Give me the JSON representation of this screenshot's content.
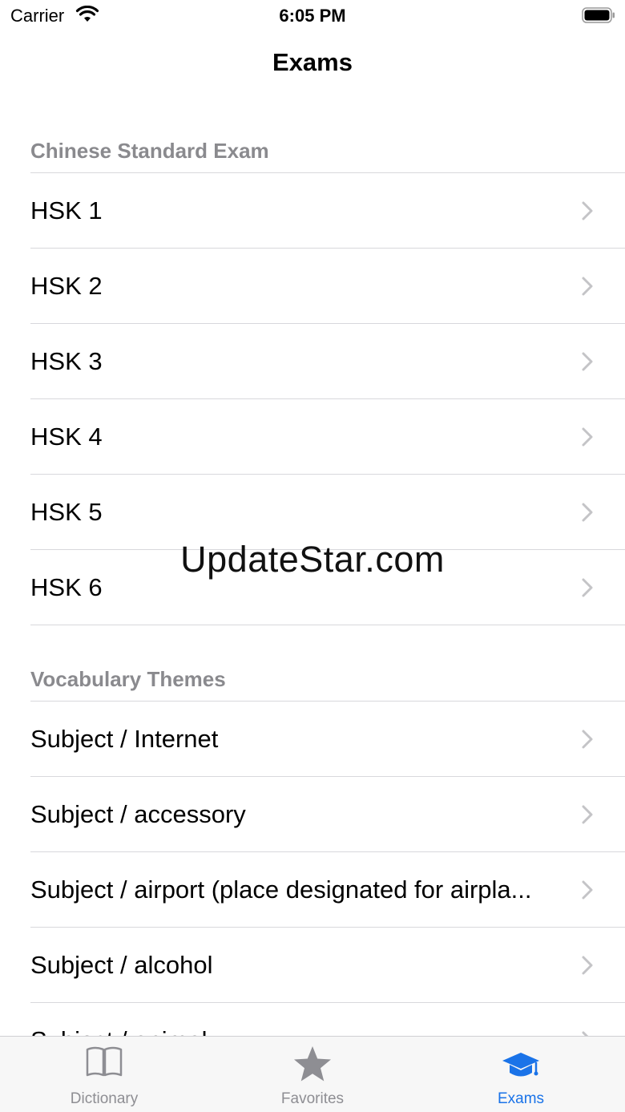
{
  "status": {
    "carrier": "Carrier",
    "time": "6:05 PM"
  },
  "nav": {
    "title": "Exams"
  },
  "sections": [
    {
      "header": "Chinese Standard Exam",
      "items": [
        "HSK 1",
        "HSK 2",
        "HSK 3",
        "HSK 4",
        "HSK 5",
        "HSK 6"
      ]
    },
    {
      "header": "Vocabulary Themes",
      "items": [
        "Subject / Internet",
        "Subject / accessory",
        "Subject / airport (place designated for airpla...",
        "Subject / alcohol",
        "Subject / animal"
      ]
    }
  ],
  "watermark": "UpdateStar.com",
  "tabs": [
    {
      "label": "Dictionary",
      "icon": "book-icon",
      "active": false
    },
    {
      "label": "Favorites",
      "icon": "star-icon",
      "active": false
    },
    {
      "label": "Exams",
      "icon": "graduation-cap-icon",
      "active": true
    }
  ],
  "colors": {
    "accent": "#1a73e8",
    "section_header": "#8a8a8e",
    "inactive_tab": "#8e8e93"
  }
}
